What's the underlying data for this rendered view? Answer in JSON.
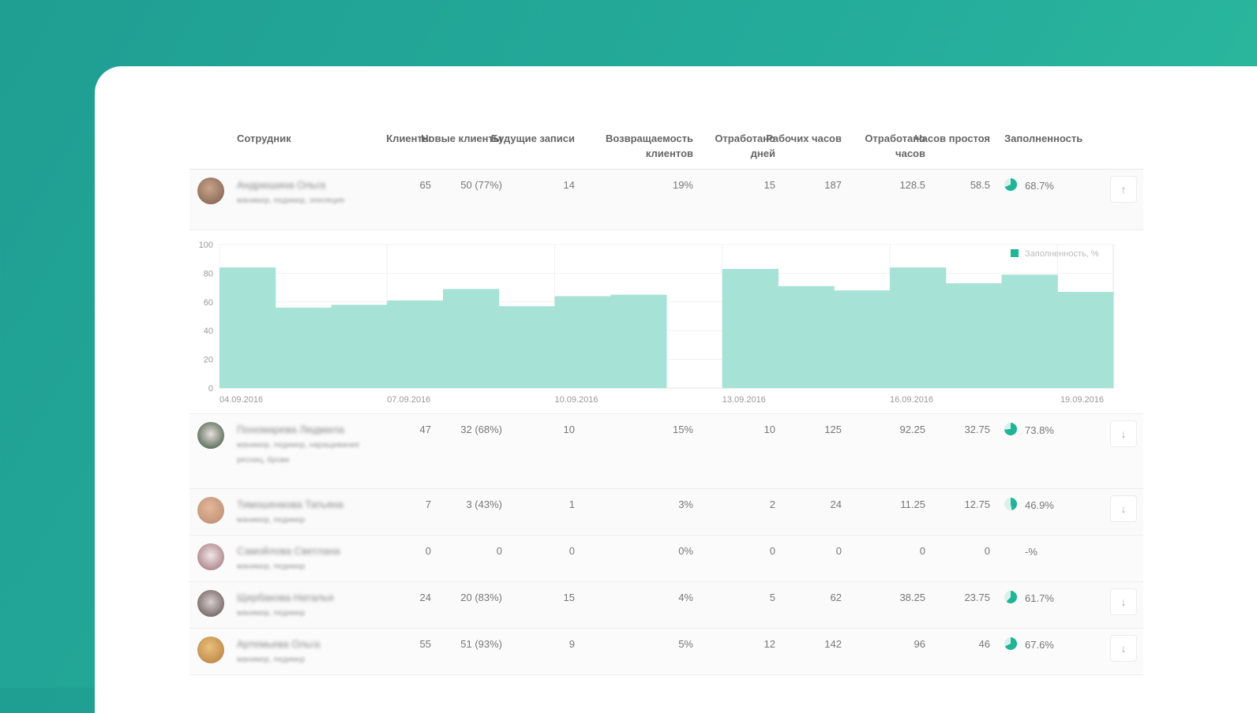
{
  "colors": {
    "accent": "#1fb597",
    "bar": "#a6e2d5",
    "bg": "#25ad9b"
  },
  "table": {
    "headers": [
      {
        "key": "employee",
        "label": "Сотрудник"
      },
      {
        "key": "clients",
        "label": "Клиенты"
      },
      {
        "key": "new",
        "label": "Новые клиенты"
      },
      {
        "key": "future",
        "label": "Будущие записи"
      },
      {
        "key": "return",
        "label": "Возвращаемость клиентов"
      },
      {
        "key": "days",
        "label": "Отработано дней"
      },
      {
        "key": "hours",
        "label": "Рабочих часов"
      },
      {
        "key": "worked",
        "label": "Отработано часов"
      },
      {
        "key": "idle",
        "label": "Часов простоя"
      },
      {
        "key": "fill",
        "label": "Заполненность"
      }
    ],
    "rows": [
      {
        "name": "Андрюшина Ольга",
        "role": "маникюр, педикюр, эпиляция",
        "clients": "65",
        "new": "50 (77%)",
        "future": "14",
        "return": "19%",
        "days": "15",
        "hours": "187",
        "worked": "128.5",
        "idle": "58.5",
        "fill": "68.7%",
        "fill_value": 68.7,
        "button_icon": "arrow-up-icon",
        "button": "↑"
      },
      {
        "name": "Пономарева Людмила",
        "role": "маникюр, педикюр, наращивание ресниц, брови",
        "clients": "47",
        "new": "32 (68%)",
        "future": "10",
        "return": "15%",
        "days": "10",
        "hours": "125",
        "worked": "92.25",
        "idle": "32.75",
        "fill": "73.8%",
        "fill_value": 73.8,
        "button_icon": "arrow-down-icon",
        "button": "↓"
      },
      {
        "name": "Тимошенкова Татьяна",
        "role": "маникюр, педикюр",
        "clients": "7",
        "new": "3 (43%)",
        "future": "1",
        "return": "3%",
        "days": "2",
        "hours": "24",
        "worked": "11.25",
        "idle": "12.75",
        "fill": "46.9%",
        "fill_value": 46.9,
        "button_icon": "arrow-down-icon",
        "button": "↓"
      },
      {
        "name": "Самойлова Светлана",
        "role": "маникюр, педикюр",
        "clients": "0",
        "new": "0",
        "future": "0",
        "return": "0%",
        "days": "0",
        "hours": "0",
        "worked": "0",
        "idle": "0",
        "fill": "-%",
        "fill_value": 0,
        "button_icon": "",
        "button": ""
      },
      {
        "name": "Щербакова Наталья",
        "role": "маникюр, педикюр",
        "clients": "24",
        "new": "20 (83%)",
        "future": "15",
        "return": "4%",
        "days": "5",
        "hours": "62",
        "worked": "38.25",
        "idle": "23.75",
        "fill": "61.7%",
        "fill_value": 61.7,
        "button_icon": "arrow-down-icon",
        "button": "↓"
      },
      {
        "name": "Артемьева Ольга",
        "role": "маникюр, педикюр",
        "clients": "55",
        "new": "51 (93%)",
        "future": "9",
        "return": "5%",
        "days": "12",
        "hours": "142",
        "worked": "96",
        "idle": "46",
        "fill": "67.6%",
        "fill_value": 67.6,
        "button_icon": "arrow-down-icon",
        "button": "↓"
      }
    ]
  },
  "chart_data": {
    "type": "bar",
    "legend": "Заполненность, %",
    "legend_position": "top-right",
    "ylim": [
      0,
      100
    ],
    "yticks": [
      "0",
      "20",
      "40",
      "60",
      "80",
      "100"
    ],
    "xtick_labels": [
      "04.09.2016",
      "07.09.2016",
      "10.09.2016",
      "13.09.2016",
      "16.09.2016",
      "19.09.2016"
    ],
    "categories": [
      "04.09.2016",
      "05.09.2016",
      "06.09.2016",
      "07.09.2016",
      "08.09.2016",
      "09.09.2016",
      "10.09.2016",
      "11.09.2016",
      "12.09.2016",
      "13.09.2016",
      "14.09.2016",
      "15.09.2016",
      "16.09.2016",
      "17.09.2016",
      "18.09.2016",
      "19.09.2016"
    ],
    "values": [
      84,
      56,
      58,
      61,
      69,
      57,
      64,
      65,
      0,
      83,
      71,
      68,
      84,
      73,
      79,
      67
    ]
  }
}
